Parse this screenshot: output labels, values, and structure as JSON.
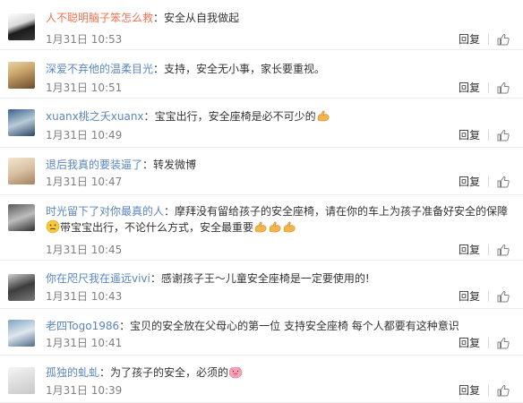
{
  "comments": [
    {
      "user": "人不聪明脑子笨怎么救",
      "text": "安全从自我做起",
      "date": "1月31日 10:53",
      "emoji": []
    },
    {
      "user": "深爱不弃他的温柔目光",
      "text": "支持，安全无小事，家长要重视。",
      "date": "1月31日 10:51",
      "emoji": []
    },
    {
      "user": "xuanx桃之夭xuanx",
      "text": "宝宝出行，安全座椅是必不可少的",
      "date": "1月31日 10:49",
      "emoji": [
        "muscle-emoji"
      ]
    },
    {
      "user": "退后我真的要装逼了",
      "text": "转发微博",
      "date": "1月31日 10:47",
      "emoji": []
    },
    {
      "user": "时光留下了对你最真的人",
      "text": "摩拜没有留给孩子的安全座椅，请在你的车上为孩子准备好安全的保障",
      "text2": "带宝宝出行，不论什么方式，安全最重要",
      "date": "1月31日 10:45",
      "emoji": [
        "muscle-emoji",
        "muscle-emoji",
        "muscle-emoji"
      ]
    },
    {
      "user": "你在咫尺我在遥远vivi",
      "text": "感谢孩子王～儿童安全座椅是一定要使用的!",
      "date": "1月31日 10:43",
      "emoji": []
    },
    {
      "user": "老四Togo1986",
      "text": "宝贝的安全放在父母心的第一位 支持安全座椅 每个人都要有这种意识",
      "date": "1月31日 10:41",
      "emoji": []
    },
    {
      "user": "孤独的虬虬",
      "text": "为了孩子的安全，必须的",
      "date": "1月31日 10:39",
      "emoji": [
        "pig-emoji"
      ]
    }
  ],
  "labels": {
    "reply": "回复",
    "colon": "："
  },
  "colors": {
    "username_orange": "#eb7350",
    "username_blue": "#5b86be",
    "meta_gray": "#808080"
  }
}
